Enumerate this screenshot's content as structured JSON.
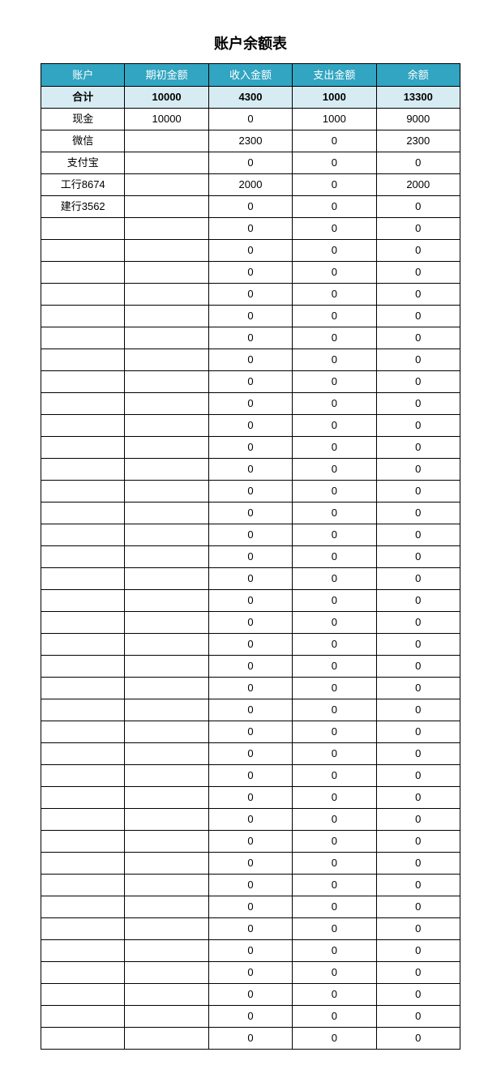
{
  "title": "账户余额表",
  "headers": {
    "account": "账户",
    "initial": "期初金额",
    "income": "收入金额",
    "expense": "支出金额",
    "balance": "余额"
  },
  "total": {
    "label": "合计",
    "initial": "10000",
    "income": "4300",
    "expense": "1000",
    "balance": "13300"
  },
  "rows": [
    {
      "account": "现金",
      "initial": "10000",
      "income": "0",
      "expense": "1000",
      "balance": "9000"
    },
    {
      "account": "微信",
      "initial": "",
      "income": "2300",
      "expense": "0",
      "balance": "2300"
    },
    {
      "account": "支付宝",
      "initial": "",
      "income": "0",
      "expense": "0",
      "balance": "0"
    },
    {
      "account": "工行8674",
      "initial": "",
      "income": "2000",
      "expense": "0",
      "balance": "2000"
    },
    {
      "account": "建行3562",
      "initial": "",
      "income": "0",
      "expense": "0",
      "balance": "0"
    },
    {
      "account": "",
      "initial": "",
      "income": "0",
      "expense": "0",
      "balance": "0"
    },
    {
      "account": "",
      "initial": "",
      "income": "0",
      "expense": "0",
      "balance": "0"
    },
    {
      "account": "",
      "initial": "",
      "income": "0",
      "expense": "0",
      "balance": "0"
    },
    {
      "account": "",
      "initial": "",
      "income": "0",
      "expense": "0",
      "balance": "0"
    },
    {
      "account": "",
      "initial": "",
      "income": "0",
      "expense": "0",
      "balance": "0"
    },
    {
      "account": "",
      "initial": "",
      "income": "0",
      "expense": "0",
      "balance": "0"
    },
    {
      "account": "",
      "initial": "",
      "income": "0",
      "expense": "0",
      "balance": "0"
    },
    {
      "account": "",
      "initial": "",
      "income": "0",
      "expense": "0",
      "balance": "0"
    },
    {
      "account": "",
      "initial": "",
      "income": "0",
      "expense": "0",
      "balance": "0"
    },
    {
      "account": "",
      "initial": "",
      "income": "0",
      "expense": "0",
      "balance": "0"
    },
    {
      "account": "",
      "initial": "",
      "income": "0",
      "expense": "0",
      "balance": "0"
    },
    {
      "account": "",
      "initial": "",
      "income": "0",
      "expense": "0",
      "balance": "0"
    },
    {
      "account": "",
      "initial": "",
      "income": "0",
      "expense": "0",
      "balance": "0"
    },
    {
      "account": "",
      "initial": "",
      "income": "0",
      "expense": "0",
      "balance": "0"
    },
    {
      "account": "",
      "initial": "",
      "income": "0",
      "expense": "0",
      "balance": "0"
    },
    {
      "account": "",
      "initial": "",
      "income": "0",
      "expense": "0",
      "balance": "0"
    },
    {
      "account": "",
      "initial": "",
      "income": "0",
      "expense": "0",
      "balance": "0"
    },
    {
      "account": "",
      "initial": "",
      "income": "0",
      "expense": "0",
      "balance": "0"
    },
    {
      "account": "",
      "initial": "",
      "income": "0",
      "expense": "0",
      "balance": "0"
    },
    {
      "account": "",
      "initial": "",
      "income": "0",
      "expense": "0",
      "balance": "0"
    },
    {
      "account": "",
      "initial": "",
      "income": "0",
      "expense": "0",
      "balance": "0"
    },
    {
      "account": "",
      "initial": "",
      "income": "0",
      "expense": "0",
      "balance": "0"
    },
    {
      "account": "",
      "initial": "",
      "income": "0",
      "expense": "0",
      "balance": "0"
    },
    {
      "account": "",
      "initial": "",
      "income": "0",
      "expense": "0",
      "balance": "0"
    },
    {
      "account": "",
      "initial": "",
      "income": "0",
      "expense": "0",
      "balance": "0"
    },
    {
      "account": "",
      "initial": "",
      "income": "0",
      "expense": "0",
      "balance": "0"
    },
    {
      "account": "",
      "initial": "",
      "income": "0",
      "expense": "0",
      "balance": "0"
    },
    {
      "account": "",
      "initial": "",
      "income": "0",
      "expense": "0",
      "balance": "0"
    },
    {
      "account": "",
      "initial": "",
      "income": "0",
      "expense": "0",
      "balance": "0"
    },
    {
      "account": "",
      "initial": "",
      "income": "0",
      "expense": "0",
      "balance": "0"
    },
    {
      "account": "",
      "initial": "",
      "income": "0",
      "expense": "0",
      "balance": "0"
    },
    {
      "account": "",
      "initial": "",
      "income": "0",
      "expense": "0",
      "balance": "0"
    },
    {
      "account": "",
      "initial": "",
      "income": "0",
      "expense": "0",
      "balance": "0"
    },
    {
      "account": "",
      "initial": "",
      "income": "0",
      "expense": "0",
      "balance": "0"
    },
    {
      "account": "",
      "initial": "",
      "income": "0",
      "expense": "0",
      "balance": "0"
    },
    {
      "account": "",
      "initial": "",
      "income": "0",
      "expense": "0",
      "balance": "0"
    },
    {
      "account": "",
      "initial": "",
      "income": "0",
      "expense": "0",
      "balance": "0"
    },
    {
      "account": "",
      "initial": "",
      "income": "0",
      "expense": "0",
      "balance": "0"
    }
  ]
}
